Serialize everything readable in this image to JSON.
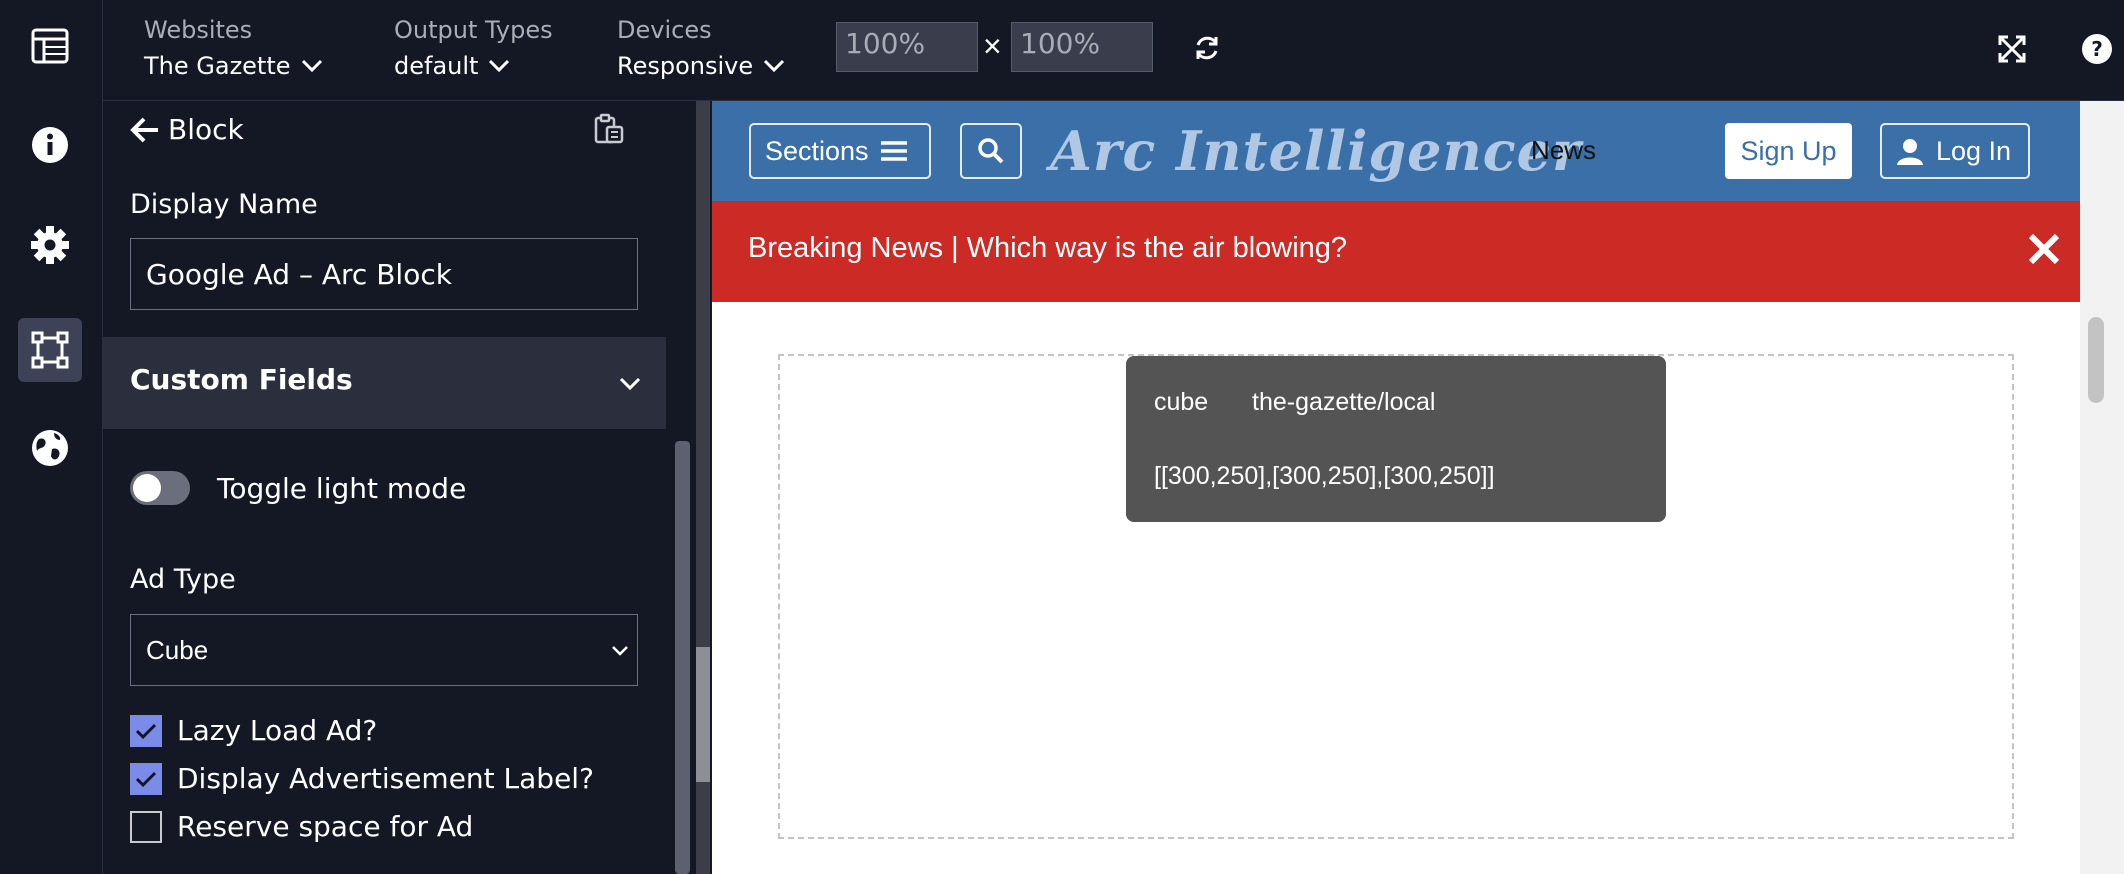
{
  "rail": {
    "icons": [
      "layout-icon",
      "info-icon",
      "gear-icon",
      "block-select-icon",
      "globe-icon"
    ]
  },
  "topbar": {
    "websites": {
      "label": "Websites",
      "value": "The Gazette"
    },
    "output_types": {
      "label": "Output Types",
      "value": "default"
    },
    "devices": {
      "label": "Devices",
      "value": "Responsive"
    },
    "width_value": "100%",
    "height_value": "100%",
    "times": "×"
  },
  "panel": {
    "back_label": "Block",
    "display_name_label": "Display Name",
    "display_name_value": "Google Ad – Arc Block",
    "custom_fields_label": "Custom Fields",
    "toggle_label": "Toggle light mode",
    "ad_type_label": "Ad Type",
    "ad_type_value": "Cube",
    "checkboxes": [
      {
        "label": "Lazy Load Ad?",
        "checked": true
      },
      {
        "label": "Display Advertisement Label?",
        "checked": true
      },
      {
        "label": "Reserve space for Ad",
        "checked": false
      }
    ]
  },
  "site": {
    "sections_label": "Sections",
    "logo_text": "Arc Intelligencer",
    "nav_news": "News",
    "signup_label": "Sign Up",
    "login_label": "Log In",
    "breaking_text": "Breaking News | Which way is the air blowing?",
    "ad_type": "cube",
    "ad_slot": "the-gazette/local",
    "ad_sizes": "[[300,250],[300,250],[300,250]]"
  },
  "colors": {
    "brand_blue": "#3a6fa8",
    "breaking_red": "#cc2a24",
    "checkbox_accent": "#7b8ce8"
  }
}
